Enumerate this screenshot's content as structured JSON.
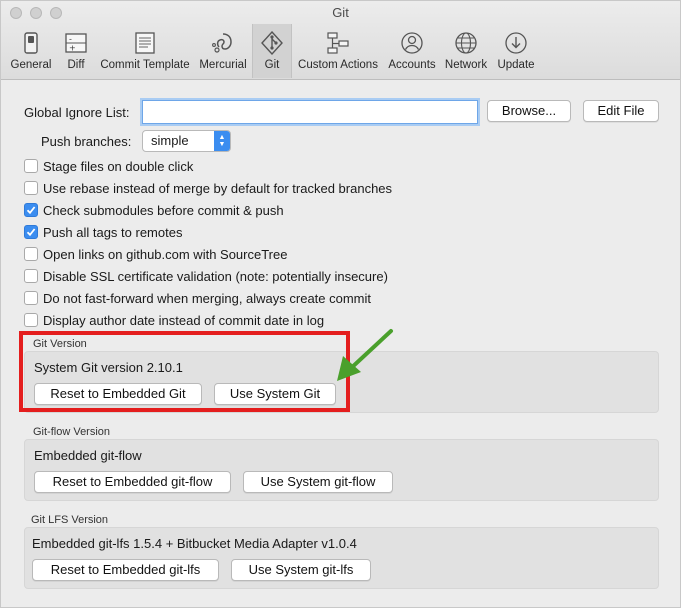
{
  "window": {
    "title": "Git"
  },
  "toolbar": {
    "items": [
      {
        "label": "General",
        "icon": "switch-icon"
      },
      {
        "label": "Diff",
        "icon": "diff-icon"
      },
      {
        "label": "Commit Template",
        "icon": "document-icon"
      },
      {
        "label": "Mercurial",
        "icon": "mercurial-icon"
      },
      {
        "label": "Git",
        "icon": "git-icon",
        "active": true
      },
      {
        "label": "Custom Actions",
        "icon": "flowchart-icon"
      },
      {
        "label": "Accounts",
        "icon": "person-icon"
      },
      {
        "label": "Network",
        "icon": "globe-icon"
      },
      {
        "label": "Update",
        "icon": "download-icon"
      }
    ]
  },
  "global_ignore": {
    "label": "Global Ignore List:",
    "value": "",
    "browse_label": "Browse...",
    "edit_label": "Edit File"
  },
  "push_branches": {
    "label": "Push branches:",
    "selected": "simple"
  },
  "options": [
    {
      "label": "Stage files on double click",
      "checked": false
    },
    {
      "label": "Use rebase instead of merge by default for tracked branches",
      "checked": false
    },
    {
      "label": "Check submodules before commit & push",
      "checked": true
    },
    {
      "label": "Push all tags to remotes",
      "checked": true
    },
    {
      "label": "Open links on github.com with SourceTree",
      "checked": false
    },
    {
      "label": "Disable SSL certificate validation (note: potentially insecure)",
      "checked": false
    },
    {
      "label": "Do not fast-forward when merging, always create commit",
      "checked": false
    },
    {
      "label": "Display author date instead of commit date in log",
      "checked": false
    }
  ],
  "git_version": {
    "title": "Git Version",
    "status": "System Git version 2.10.1",
    "reset_label": "Reset to Embedded Git",
    "use_system_label": "Use System Git"
  },
  "gitflow_version": {
    "title": "Git-flow Version",
    "status": "Embedded git-flow",
    "reset_label": "Reset to Embedded git-flow",
    "use_system_label": "Use System git-flow"
  },
  "gitlfs_version": {
    "title": "Git LFS Version",
    "status": "Embedded git-lfs 1.5.4 + Bitbucket Media Adapter v1.0.4",
    "reset_label": "Reset to Embedded git-lfs",
    "use_system_label": "Use System git-lfs"
  },
  "annotation": {
    "highlight_color": "#e41e1e",
    "arrow_color": "#4aa02c"
  },
  "colors": {
    "accent": "#3b8df0",
    "window_bg": "#ececec"
  }
}
